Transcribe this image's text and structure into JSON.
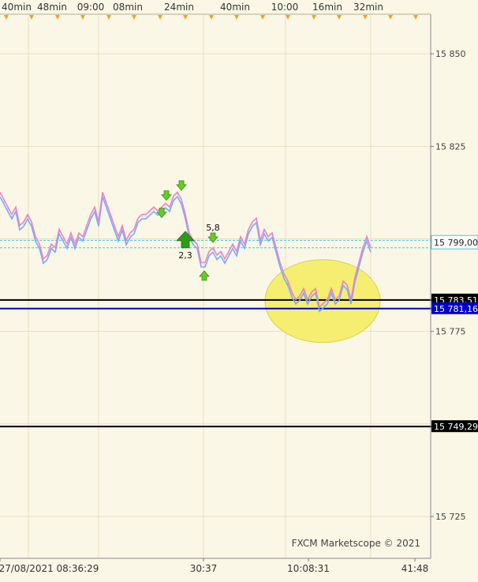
{
  "chart_data": {
    "type": "line",
    "top_time_labels": [
      "40min",
      "48min",
      "09:00",
      "08min",
      "24min",
      "40min",
      "10:00",
      "16min",
      "32min"
    ],
    "bottom_time_labels": [
      "27/08/2021 08:36:29",
      "30:37",
      "10:08:31",
      "41:48"
    ],
    "y_ticks": [
      "15 850",
      "15 825",
      "15 775",
      "15 725"
    ],
    "ylim": [
      15713.7,
      15860.7
    ],
    "xlim": [
      0,
      546
    ],
    "watermark": "FXCM Marketscope © 2021",
    "colors": {
      "background": "#fbf7e6",
      "grid": "#e7dfc3",
      "up_series": "#ee82c8",
      "down_series": "#6fb0ff",
      "bid_ask_line": "#45c5de",
      "highlight_fill": "#f6ee70",
      "hline_black": "#000000",
      "hline_blue": "#0000cc",
      "marker_green": "#2e9a1a",
      "marker_light_green": "#66cc22",
      "top_marker": "#f0a030"
    },
    "series": [
      {
        "x": [
          0,
          5,
          10,
          15,
          20,
          25,
          30,
          35,
          40,
          45,
          50,
          55,
          60,
          65,
          70,
          75,
          80,
          85,
          90,
          95,
          100,
          105,
          110,
          115,
          120,
          125,
          130,
          135,
          140,
          145,
          150,
          155,
          160,
          165,
          170,
          175,
          180,
          185,
          190,
          195,
          200,
          205,
          210,
          215,
          220,
          225,
          230,
          235,
          240,
          245,
          250,
          255,
          260,
          265,
          270,
          275,
          280,
          285,
          290,
          295,
          300,
          305,
          310,
          315,
          320,
          325,
          330,
          335,
          340,
          345,
          350,
          355,
          360,
          365,
          370,
          375,
          380,
          385,
          390,
          395,
          400,
          405,
          410,
          415,
          420,
          425,
          430,
          435,
          440,
          445,
          450,
          455,
          460,
          465,
          470
        ],
        "values": [
          15812,
          15810,
          15808,
          15806,
          15808,
          15803,
          15804,
          15806,
          15804,
          15800,
          15798,
          15794,
          15795,
          15798,
          15797,
          15802,
          15800,
          15798,
          15801,
          15798,
          15801,
          15800,
          15803,
          15806,
          15808,
          15804,
          15812,
          15809,
          15806,
          15803,
          15800,
          15803,
          15799,
          15801,
          15802,
          15805,
          15806,
          15806,
          15807,
          15808,
          15807,
          15808,
          15809,
          15808,
          15811,
          15812,
          15810,
          15806,
          15801,
          15799,
          15798,
          15793,
          15793,
          15796,
          15797,
          15795,
          15796,
          15794,
          15796,
          15798,
          15796,
          15800,
          15798,
          15802,
          15804,
          15805,
          15799,
          15802,
          15800,
          15801,
          15797,
          15793,
          15790,
          15788,
          15785,
          15783,
          15784,
          15786,
          15783,
          15785,
          15786,
          15781,
          15782,
          15783,
          15786,
          15783,
          15784,
          15788,
          15787,
          15783,
          15789,
          15793,
          15797,
          15800,
          15797
        ]
      }
    ],
    "bid_ask_levels": [
      15799.6,
      15797.6
    ],
    "horizontal_lines": [
      {
        "price": 15783.5,
        "color": "black",
        "label": "15 783,51"
      },
      {
        "price": 15781.16,
        "color": "blue",
        "label": "15 781,16"
      },
      {
        "price": 15749.29,
        "color": "black",
        "label": "15 749,29"
      }
    ],
    "current_price_label": "15 799,00",
    "current_price": 15799.0,
    "annotations": [
      {
        "text": "2,3",
        "type": "big-up-arrow",
        "x": 235,
        "price": 15799.7
      },
      {
        "text": "5,8",
        "type": "small-down-arrow",
        "x": 270,
        "price": 15800.1
      }
    ],
    "signal_markers": [
      {
        "type": "down",
        "x": 211,
        "price": 15811.5
      },
      {
        "type": "down",
        "x": 205,
        "price": 15806.8
      },
      {
        "type": "down",
        "x": 230,
        "price": 15814.2
      },
      {
        "type": "up",
        "x": 259,
        "price": 15790.3
      }
    ],
    "highlight_ellipse": {
      "cx": 409,
      "cy": 15783.2,
      "rx": 73,
      "ry": 11.2
    }
  }
}
